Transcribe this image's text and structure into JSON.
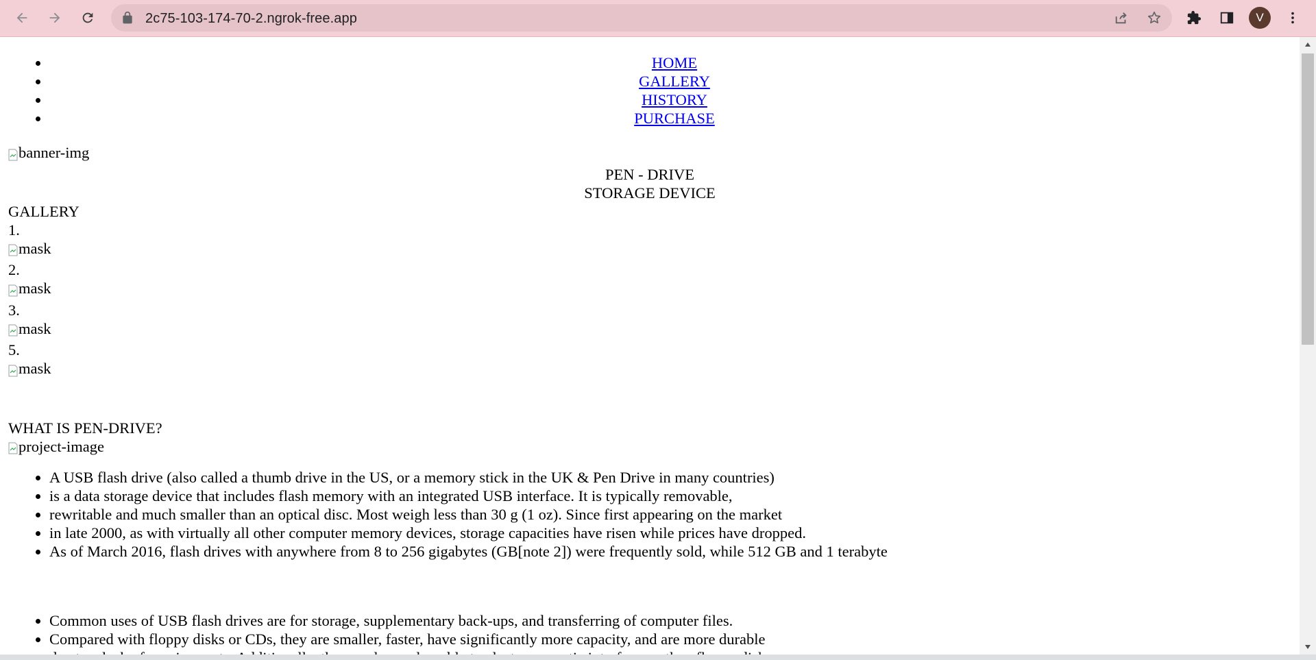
{
  "browser": {
    "url": "2c75-103-174-70-2.ngrok-free.app",
    "avatar_letter": "V"
  },
  "nav": {
    "items": [
      "HOME",
      "GALLERY",
      "HISTORY",
      "PURCHASE"
    ]
  },
  "banner": {
    "alt": "banner-img",
    "line1": "PEN - DRIVE",
    "line2": "STORAGE DEVICE"
  },
  "gallery": {
    "heading": "GALLERY",
    "items": [
      {
        "number": "1.",
        "alt": "mask"
      },
      {
        "number": "2.",
        "alt": "mask"
      },
      {
        "number": "3.",
        "alt": "mask"
      },
      {
        "number": "5.",
        "alt": "mask"
      }
    ]
  },
  "about": {
    "heading": "WHAT IS PEN-DRIVE?",
    "image_alt": "project-image",
    "bullets_1": [
      "A USB flash drive (also called a thumb drive in the US, or a memory stick in the UK & Pen Drive in many countries)",
      "is a data storage device that includes flash memory with an integrated USB interface. It is typically removable,",
      "rewritable and much smaller than an optical disc. Most weigh less than 30 g (1 oz). Since first appearing on the market",
      "in late 2000, as with virtually all other computer memory devices, storage capacities have risen while prices have dropped.",
      "As of March 2016, flash drives with anywhere from 8 to 256 gigabytes (GB[note 2]) were frequently sold, while 512 GB and 1 terabyte"
    ],
    "bullets_2": [
      "Common uses of USB flash drives are for storage, supplementary back-ups, and transferring of computer files.",
      "Compared with floppy disks or CDs, they are smaller, faster, have significantly more capacity, and are more durable",
      "due to a lack of moving parts. Additionally, they are less vulnerable to electromagnetic interference than floppy disks,"
    ]
  },
  "colors": {
    "chrome_bg": "#f2d0d5",
    "omnibox_bg": "#e6c3c8",
    "link": "#0000ee"
  }
}
